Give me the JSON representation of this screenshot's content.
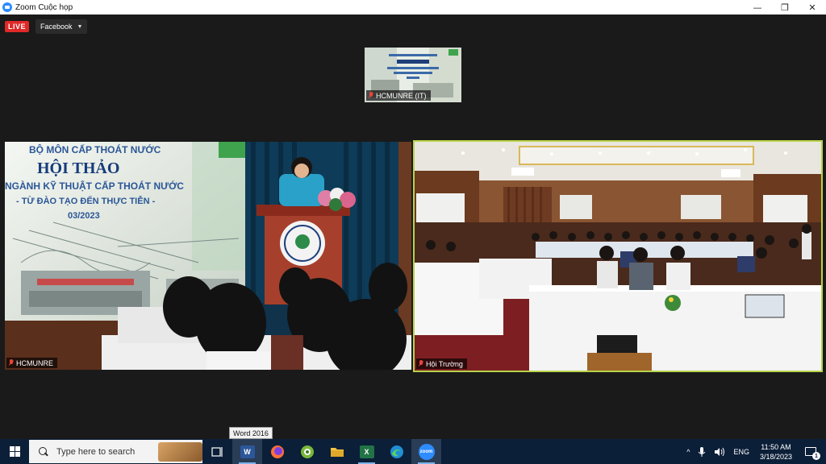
{
  "window": {
    "title": "Zoom Cuộc họp",
    "controls": {
      "minimize": "—",
      "maximize": "❐",
      "close": "✕"
    }
  },
  "meeting": {
    "live_label": "LIVE",
    "stream_label": "Facebook",
    "colors": {
      "live": "#e02828",
      "active_speaker_border": "#b8d34a"
    },
    "thumbnail": {
      "label": "HCMUNRE (IT)"
    },
    "tiles": [
      {
        "label": "HCMUNRE",
        "slide": {
          "line1": "BỘ MÔN CẤP THOÁT NƯỚC",
          "line2": "HỘI THẢO",
          "line3": "NGÀNH KỸ THUẬT CẤP THOÁT NƯỚC",
          "line4": "- TỪ ĐÀO TẠO ĐẾN THỰC TIỄN -",
          "line5": "03/2023"
        }
      },
      {
        "label": "Hội Trường"
      }
    ]
  },
  "tooltip": {
    "text": "Word 2016"
  },
  "taskbar": {
    "search_placeholder": "Type here to search",
    "apps": [
      {
        "name": "task-view",
        "icon": "task-view-icon"
      },
      {
        "name": "word",
        "icon": "word-icon",
        "glyph": "W"
      },
      {
        "name": "firefox",
        "icon": "firefox-icon"
      },
      {
        "name": "greenshot",
        "icon": "greenshot-icon"
      },
      {
        "name": "file-explorer",
        "icon": "folder-icon"
      },
      {
        "name": "excel",
        "icon": "excel-icon",
        "glyph": "X"
      },
      {
        "name": "edge",
        "icon": "edge-icon"
      },
      {
        "name": "zoom",
        "icon": "zoom-icon",
        "glyph": "zoom"
      }
    ],
    "tray": {
      "chevron": "^",
      "language": "ENG",
      "time": "11:50 AM",
      "date": "3/18/2023",
      "notification_count": "1"
    }
  }
}
